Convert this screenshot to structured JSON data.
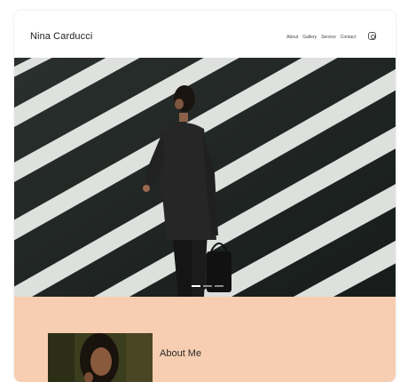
{
  "header": {
    "site_title": "Nina Carducci",
    "nav": [
      "About",
      "Gallery",
      "Service",
      "Contact"
    ],
    "social_icon": "instagram-icon"
  },
  "hero": {
    "slide_count": 3,
    "active_slide": 1
  },
  "about": {
    "title": "About Me"
  },
  "colors": {
    "accent_background": "#f7ceb1",
    "hero_dark": "#1c2220"
  }
}
